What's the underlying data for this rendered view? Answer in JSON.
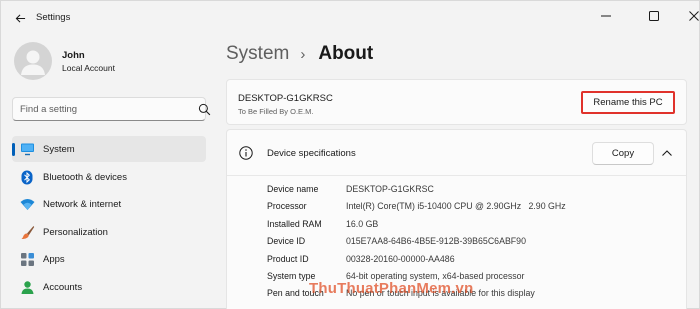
{
  "window": {
    "title": "Settings"
  },
  "profile": {
    "name": "John",
    "account_type": "Local Account"
  },
  "search": {
    "placeholder": "Find a setting"
  },
  "sidebar": {
    "items": [
      {
        "label": "System",
        "icon": "monitor-icon",
        "active": true
      },
      {
        "label": "Bluetooth & devices",
        "icon": "bluetooth-icon"
      },
      {
        "label": "Network & internet",
        "icon": "wifi-icon"
      },
      {
        "label": "Personalization",
        "icon": "brush-icon"
      },
      {
        "label": "Apps",
        "icon": "apps-icon"
      },
      {
        "label": "Accounts",
        "icon": "person-icon"
      }
    ]
  },
  "breadcrumb": {
    "parent": "System",
    "separator": "›",
    "current": "About"
  },
  "pc_card": {
    "name": "DESKTOP-G1GKRSC",
    "subtitle": "To Be Filled By O.E.M.",
    "rename_label": "Rename this PC"
  },
  "specs": {
    "title": "Device specifications",
    "copy_label": "Copy",
    "rows": [
      {
        "label": "Device name",
        "value": "DESKTOP-G1GKRSC"
      },
      {
        "label": "Processor",
        "value": "Intel(R) Core(TM) i5-10400 CPU @ 2.90GHz   2.90 GHz"
      },
      {
        "label": "Installed RAM",
        "value": "16.0 GB"
      },
      {
        "label": "Device ID",
        "value": "015E7AA8-64B6-4B5E-912B-39B65C6ABF90"
      },
      {
        "label": "Product ID",
        "value": "00328-20160-00000-AA486"
      },
      {
        "label": "System type",
        "value": "64-bit operating system, x64-based processor"
      },
      {
        "label": "Pen and touch",
        "value": "No pen or touch input is available for this display"
      }
    ]
  },
  "watermark": {
    "text": "ThuThuatPhanMem.vn"
  },
  "colors": {
    "accent": "#005fb8",
    "highlight_border": "#e0322b",
    "background": "#f3f3f3",
    "card": "#fbfbfb"
  }
}
